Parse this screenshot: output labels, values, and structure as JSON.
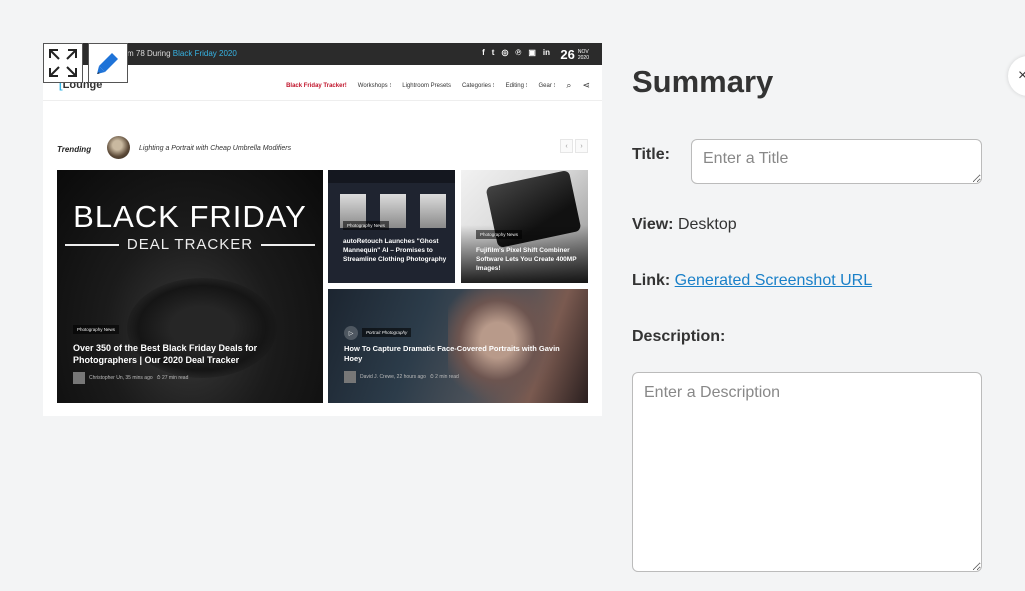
{
  "preview": {
    "topbar": {
      "promo_prefix": "m   78 During ",
      "promo_highlight": "Black Friday 2020",
      "socials": [
        "f",
        "t",
        "◎",
        "℗",
        "▣",
        "in"
      ],
      "date_day": "26",
      "date_month": "NOV",
      "date_year": "2020"
    },
    "nav": {
      "logo_mark": "[",
      "logo_text": "Lounge",
      "items": [
        "Black Friday Tracker!",
        "Workshops ⁝",
        "Lightroom Presets",
        "Categories ⁝",
        "Editing ⁝",
        "Gear ⁝"
      ],
      "search_icon": "⌕",
      "share_icon": "⋖"
    },
    "trending": {
      "label": "Trending",
      "headline": "Lighting a Portrait with Cheap Umbrella Modifiers",
      "prev": "‹",
      "next": "›"
    },
    "cards": {
      "main": {
        "banner_line1": "BLACK FRIDAY",
        "banner_line2": "DEAL TRACKER",
        "tag": "Photography News",
        "title": "Over 350 of the Best Black Friday Deals for Photographers | Our 2020 Deal Tracker",
        "author": "Christopher Un, 35 mins ago",
        "read_time": "⏱ 27 min read"
      },
      "autoretouch": {
        "tag": "Photography News",
        "title": "autoRetouch Launches \"Ghost Mannequin\" AI – Promises to Streamline Clothing Photography"
      },
      "fujifilm": {
        "tag": "Photography News",
        "title": "Fujifilm's Pixel Shift Combiner Software Lets You Create 400MP Images!"
      },
      "portrait": {
        "play_icon": "▷",
        "tag": "Portrait Photography",
        "title": "How To Capture Dramatic Face-Covered Portraits with Gavin Hoey",
        "author": "David J. Crewe, 22 hours ago",
        "read_time": "⏱ 2 min read"
      }
    }
  },
  "tools": {
    "expand_icon": "expand-icon",
    "edit_icon": "pencil-icon"
  },
  "summary": {
    "heading": "Summary",
    "title_label": "Title:",
    "title_placeholder": "Enter a Title",
    "view_label": "View:",
    "view_value": "Desktop",
    "link_label": "Link:",
    "link_text": "Generated Screenshot URL",
    "description_label": "Description:",
    "description_placeholder": "Enter a Description",
    "close_glyph": "×"
  },
  "colors": {
    "background": "#f3f4f5",
    "link": "#1a80c8",
    "accent_blue": "#36b4e5",
    "accent_red": "#c0132a"
  }
}
